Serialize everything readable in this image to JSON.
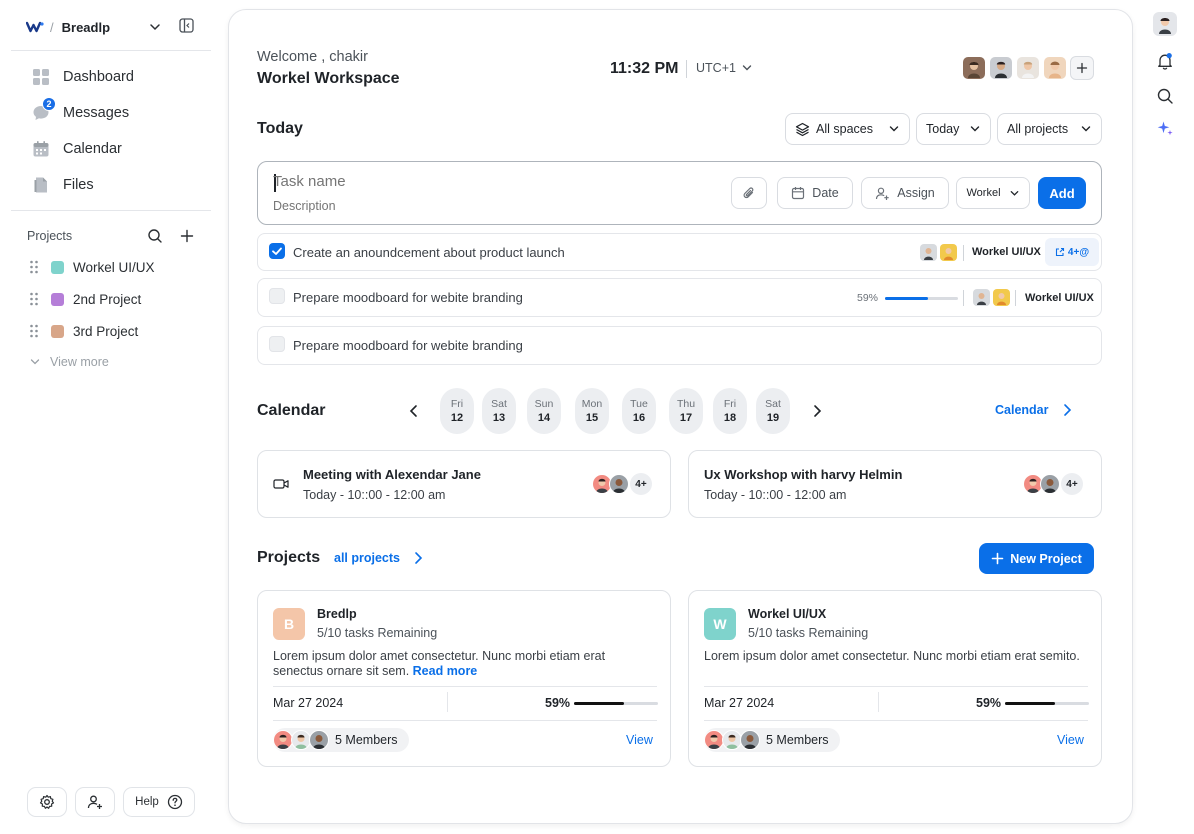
{
  "sidebar": {
    "workspace_name": "Breadlp",
    "nav": [
      {
        "label": "Dashboard",
        "icon": "dashboard-icon"
      },
      {
        "label": "Messages",
        "icon": "messages-icon",
        "badge": "2"
      },
      {
        "label": "Calendar",
        "icon": "calendar-icon"
      },
      {
        "label": "Files",
        "icon": "files-icon"
      }
    ],
    "projects_label": "Projects",
    "projects": [
      {
        "label": "Workel UI/UX",
        "color": "#7fd3cc"
      },
      {
        "label": "2nd Project",
        "color": "#b57ed8"
      },
      {
        "label": "3rd Project",
        "color": "#d8a689"
      }
    ],
    "view_more": "View more",
    "help_label": "Help"
  },
  "header": {
    "welcome": "Welcome , chakir",
    "workspace_title": "Workel Workspace",
    "time": "11:32 PM",
    "timezone": "UTC+1"
  },
  "today": {
    "title": "Today",
    "filters": {
      "spaces": "All spaces",
      "when": "Today",
      "projects": "All projects"
    },
    "composer": {
      "task_placeholder": "Task name",
      "desc_placeholder": "Description",
      "date_label": "Date",
      "assign_label": "Assign",
      "project_select": "Workel",
      "add_label": "Add"
    },
    "tasks": [
      {
        "title": "Create an anoundcement about product launch",
        "done": true,
        "project": "Workel UI/UX",
        "more": "4+@"
      },
      {
        "title": "Prepare moodboard for webite branding",
        "done": false,
        "project": "Workel UI/UX",
        "progress": "59%",
        "progress_value": 0.59
      },
      {
        "title": "Prepare moodboard for webite branding",
        "done": false
      }
    ]
  },
  "calendar": {
    "title": "Calendar",
    "link_label": "Calendar",
    "days": [
      {
        "name": "Fri",
        "date": "12"
      },
      {
        "name": "Sat",
        "date": "13"
      },
      {
        "name": "Sun",
        "date": "14"
      },
      {
        "name": "Mon",
        "date": "15"
      },
      {
        "name": "Tue",
        "date": "16"
      },
      {
        "name": "Thu",
        "date": "17"
      },
      {
        "name": "Fri",
        "date": "18"
      },
      {
        "name": "Sat",
        "date": "19"
      }
    ],
    "meetings": [
      {
        "title": "Meeting with Alexendar Jane",
        "time": "Today -  10::00 - 12:00 am",
        "count": "4+"
      },
      {
        "title": "Ux Workshop with harvy Helmin",
        "time": "Today -  10::00 - 12:00 am",
        "count": "4+"
      }
    ]
  },
  "projects": {
    "title": "Projects",
    "all_link": "all projects",
    "new_button": "New Project",
    "cards": [
      {
        "letter": "B",
        "color": "#f4c6a9",
        "name": "Bredlp",
        "remaining": "5/10 tasks Remaining",
        "desc": "Lorem ipsum dolor  amet consectetur. Nunc morbi etiam erat senectus ornare sit sem.",
        "read_more": "Read more",
        "date": "Mar 27 2024",
        "progress": "59%",
        "progress_value": 0.59,
        "members": "5 Members",
        "view": "View"
      },
      {
        "letter": "W",
        "color": "#7fd3cc",
        "name": "Workel UI/UX",
        "remaining": "5/10 tasks Remaining",
        "desc": "Lorem ipsum dolor  amet consectetur. Nunc morbi etiam erat semito.",
        "date": "Mar 27 2024",
        "progress": "59%",
        "progress_value": 0.59,
        "members": "5 Members",
        "view": "View"
      }
    ]
  },
  "colors": {
    "accent": "#0a6fe8",
    "text": "#1f2328"
  }
}
